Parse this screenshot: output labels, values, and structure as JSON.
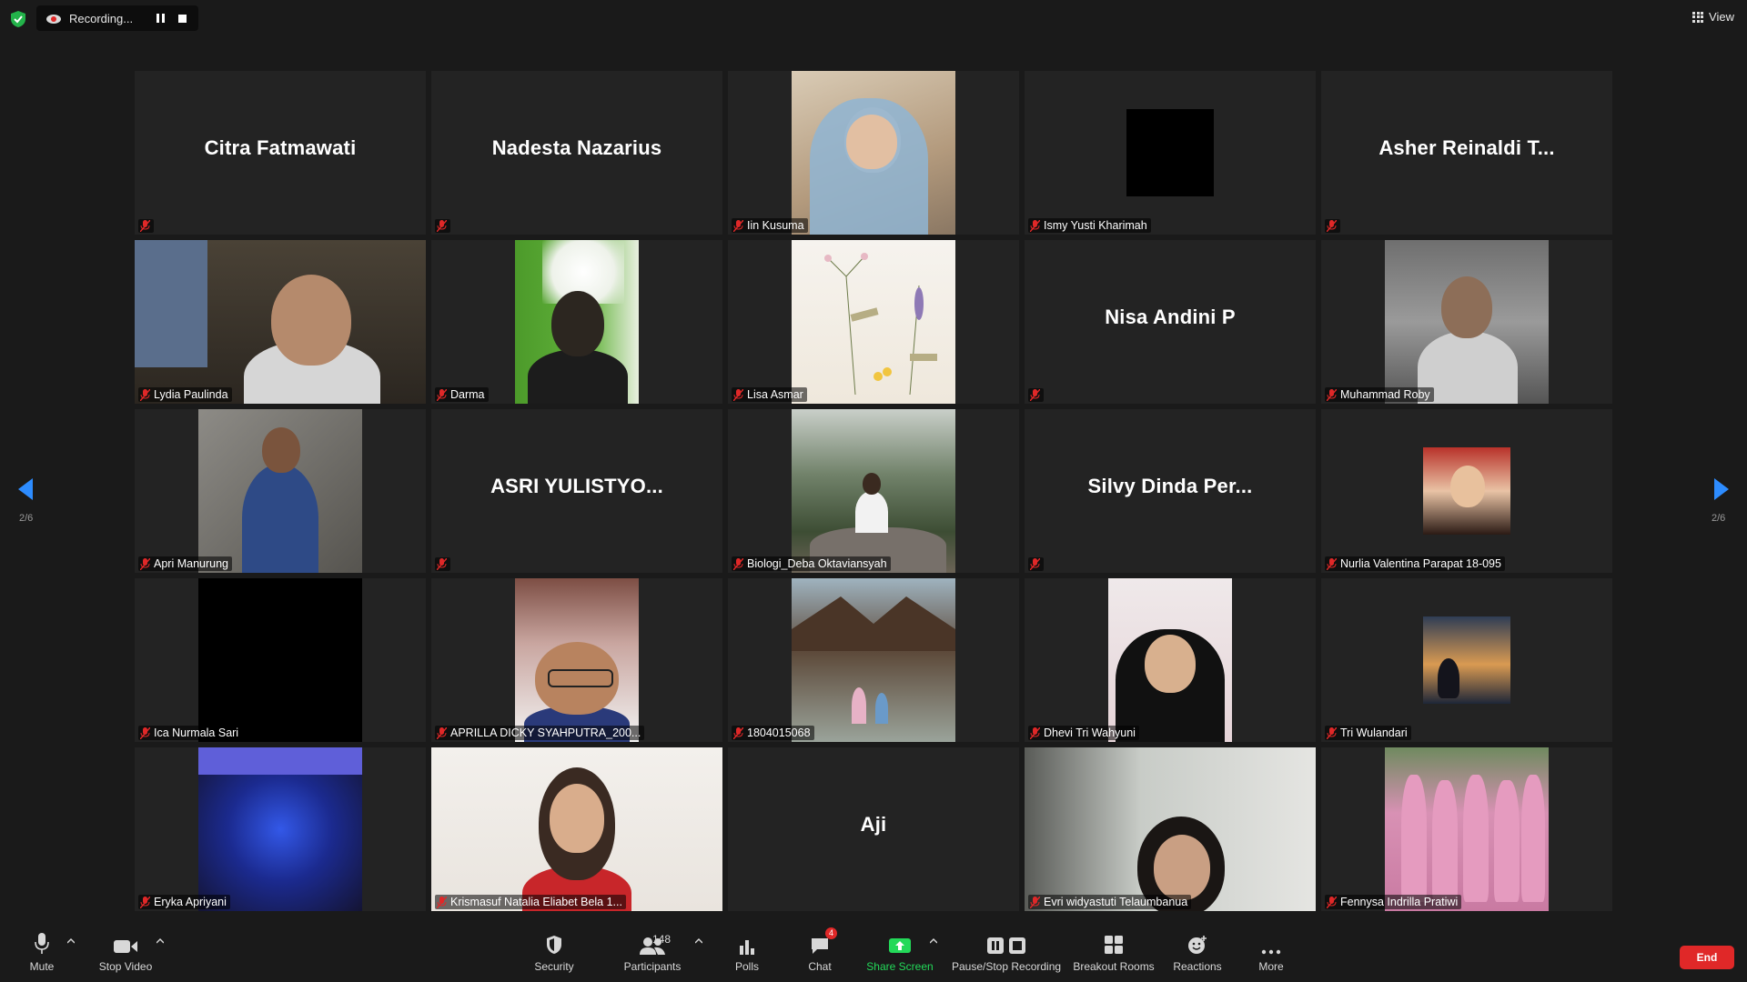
{
  "recording": {
    "status_text": "Recording..."
  },
  "view_button": {
    "label": "View"
  },
  "pagination": {
    "left_indicator": "2/6",
    "right_indicator": "2/6"
  },
  "participants": [
    {
      "name": "Citra Fatmawati",
      "video": false,
      "muted": true
    },
    {
      "name": "Nadesta Nazarius",
      "video": false,
      "muted": true
    },
    {
      "name": "Iin Kusuma",
      "video": true,
      "muted": true
    },
    {
      "name": "Ismy Yusti Kharimah",
      "video": true,
      "muted": true
    },
    {
      "name": "Asher Reinaldi T...",
      "video": false,
      "muted": true
    },
    {
      "name": "Lydia Paulinda",
      "video": true,
      "muted": true
    },
    {
      "name": "Darma",
      "video": true,
      "muted": true
    },
    {
      "name": "Lisa Asmar",
      "video": true,
      "muted": true
    },
    {
      "name": "Nisa Andini P",
      "video": false,
      "muted": true
    },
    {
      "name": "Muhammad Roby",
      "video": true,
      "muted": true
    },
    {
      "name": "Apri Manurung",
      "video": true,
      "muted": true
    },
    {
      "name": "ASRI YULISTYO...",
      "video": false,
      "muted": true
    },
    {
      "name": "Biologi_Deba Oktaviansyah",
      "video": true,
      "muted": true
    },
    {
      "name": "Silvy Dinda Per...",
      "video": false,
      "muted": true
    },
    {
      "name": "Nurlia Valentina Parapat 18-095",
      "video": true,
      "muted": true
    },
    {
      "name": "Ica Nurmala Sari",
      "video": true,
      "muted": true
    },
    {
      "name": "APRILLA DICKY SYAHPUTRA_200...",
      "video": true,
      "muted": true
    },
    {
      "name": "1804015068",
      "video": true,
      "muted": true
    },
    {
      "name": "Dhevi Tri Wahyuni",
      "video": true,
      "muted": true
    },
    {
      "name": "Tri Wulandari",
      "video": true,
      "muted": true
    },
    {
      "name": "Eryka Apriyani",
      "video": true,
      "muted": true
    },
    {
      "name": "Krismasuf Natalia Eliabet Bela 1...",
      "video": true,
      "muted": true
    },
    {
      "name": "Aji",
      "video": false,
      "muted": true
    },
    {
      "name": "Evri widyastuti Telaumbanua",
      "video": true,
      "muted": true
    },
    {
      "name": "Fennysa Indrilla Pratiwi",
      "video": true,
      "muted": true
    }
  ],
  "toolbar": {
    "mute": "Mute",
    "stop_video": "Stop Video",
    "security": "Security",
    "participants": "Participants",
    "participants_count": "148",
    "polls": "Polls",
    "chat": "Chat",
    "chat_badge": "4",
    "share_screen": "Share Screen",
    "pause_stop_recording": "Pause/Stop Recording",
    "breakout_rooms": "Breakout Rooms",
    "reactions": "Reactions",
    "more": "More",
    "end": "End"
  },
  "colors": {
    "background": "#1a1a1a",
    "tile": "#232323",
    "end_button": "#e02828",
    "share_screen_accent": "#23d959",
    "page_arrow": "#2d8cff",
    "muted_mic": "#e02828"
  }
}
